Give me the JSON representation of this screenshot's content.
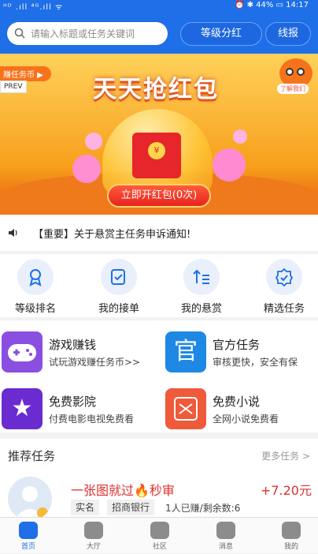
{
  "status_bar": {
    "left": "ᴴᴰ .ıll ⁴ᴳ.ıll ᯤ",
    "right": "⏰ ✱ 44% ▭ 14:17"
  },
  "search": {
    "placeholder": "请输入标题或任务关键词"
  },
  "header_buttons": {
    "level_bonus": "等级分红",
    "quick_report": "线报"
  },
  "banner": {
    "tag": "赚任务币 ▶",
    "prev": "PREV",
    "title": "天天抢红包",
    "mascot_label": "了解我们",
    "coin": "¥",
    "cta": "立即开红包(0次)"
  },
  "notice": {
    "text": "【重要】关于悬赏主任务申诉通知!"
  },
  "quick_actions": [
    {
      "label": "等级排名"
    },
    {
      "label": "我的接单"
    },
    {
      "label": "我的悬赏"
    },
    {
      "label": "精选任务"
    }
  ],
  "cards": [
    {
      "title": "游戏赚钱",
      "subtitle": "试玩游戏赚任务币>>",
      "icon_text": ""
    },
    {
      "title": "官方任务",
      "subtitle": "审核更快，安全有保",
      "icon_text": "官"
    },
    {
      "title": "免费影院",
      "subtitle": "付费电影电视免费看",
      "icon_text": "★"
    },
    {
      "title": "免费小说",
      "subtitle": "全网小说免费看",
      "icon_text": ""
    }
  ],
  "recommended": {
    "title": "推荐任务",
    "more": "更多任务 >",
    "task": {
      "title": "一张图就过🔥秒审",
      "price": "+7.20元",
      "tags": [
        "实名",
        "招商银行"
      ],
      "count": "1人已赚/剩余数:6",
      "badge": "V"
    }
  },
  "tabs": [
    {
      "label": "首页",
      "active": true
    },
    {
      "label": "大厅",
      "active": false
    },
    {
      "label": "社区",
      "active": false
    },
    {
      "label": "消息",
      "active": false
    },
    {
      "label": "我的",
      "active": false
    }
  ],
  "colors": {
    "primary": "#1e6fe8",
    "accent_red": "#e03030",
    "banner_orange": "#f7a01c"
  }
}
